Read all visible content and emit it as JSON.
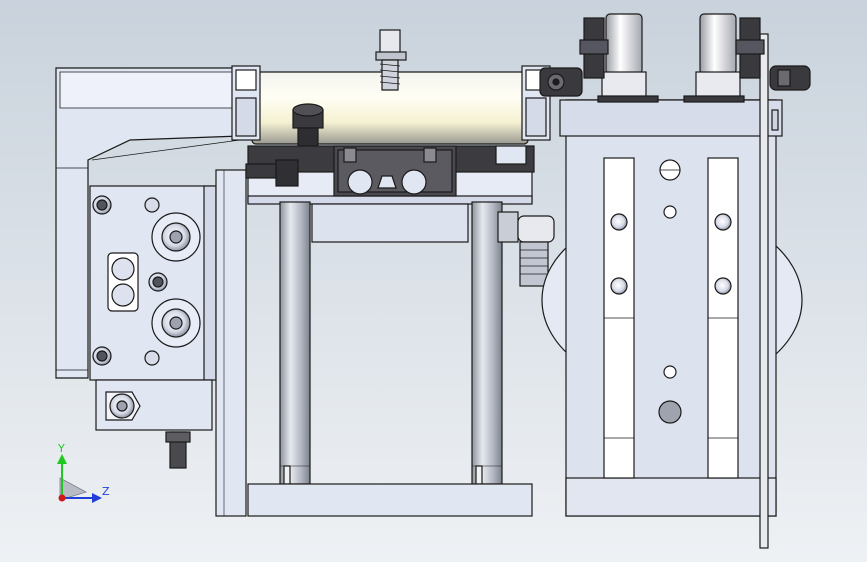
{
  "viewport": {
    "background_top": "#c9d2dc",
    "background_bottom": "#eef1f4"
  },
  "triad": {
    "y_label": "Y",
    "z_label": "Z",
    "y_color": "#1ec81e",
    "z_color": "#2040d8",
    "x_color": "#d01818"
  },
  "colors": {
    "part_fill": "#e1e6f3",
    "part_fill_dark": "#c4cade",
    "edge": "#1a1a1a",
    "cylinder_light": "#fffbe6",
    "rod": "#b9bec8",
    "dark_block": "#3c3c40"
  }
}
